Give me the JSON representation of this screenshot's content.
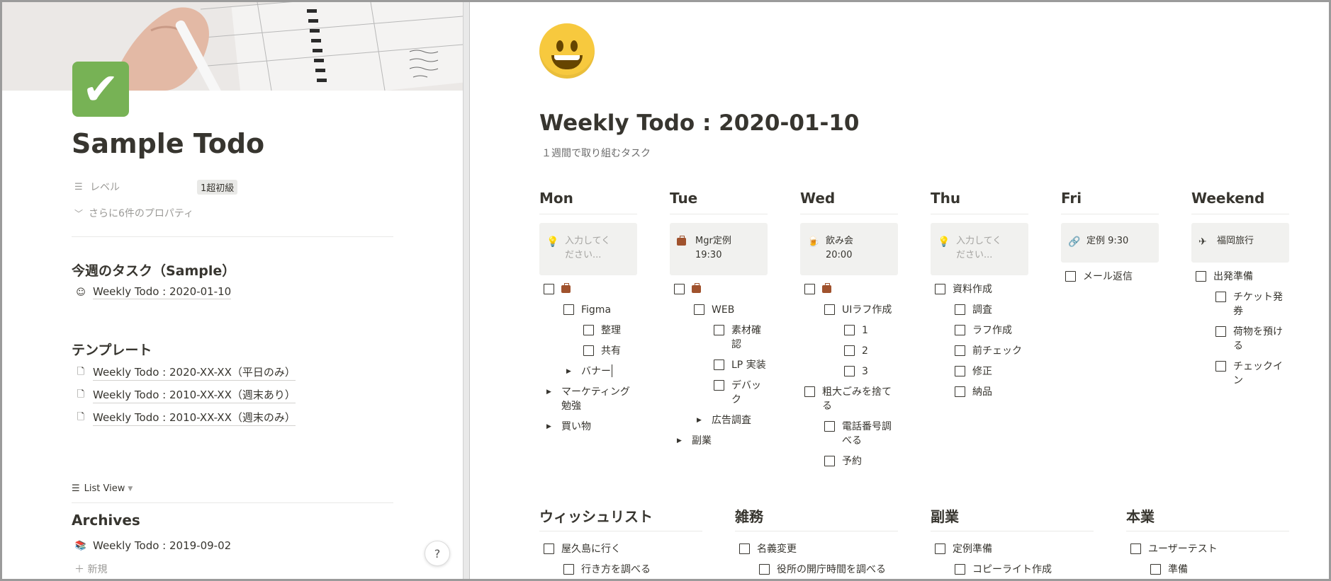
{
  "left": {
    "title": "Sample Todo",
    "property": {
      "name": "レベル",
      "value": "1超初級"
    },
    "more_properties": "さらに6件のプロパティ",
    "this_week": {
      "heading": "今週のタスク（Sample）",
      "link": "Weekly Todo : 2020-01-10"
    },
    "templates": {
      "heading": "テンプレート",
      "items": [
        "Weekly Todo : 2020-XX-XX（平日のみ）",
        "Weekly Todo : 2010-XX-XX（週末あり）",
        "Weekly Todo : 2010-XX-XX（週末のみ）"
      ]
    },
    "list_view": "List View",
    "archives": {
      "heading": "Archives",
      "item": "Weekly Todo : 2019-09-02"
    },
    "new_label": "新規",
    "help": "?"
  },
  "right": {
    "title": "Weekly Todo : 2020-01-10",
    "subtitle": "１週間で取り組むタスク",
    "days": [
      {
        "name": "Mon",
        "card": "入力してく\nださい...",
        "card_placeholder": true
      },
      {
        "name": "Tue",
        "card": "Mgr定例\n19:30"
      },
      {
        "name": "Wed",
        "card": "飲み会\n20:00"
      },
      {
        "name": "Thu",
        "card": "入力してく\nださい...",
        "card_placeholder": true
      },
      {
        "name": "Fri",
        "card": "定例 9:30"
      },
      {
        "name": "Weekend",
        "card": "福岡旅行"
      }
    ],
    "tasks": {
      "mon": [
        "Figma",
        "整理",
        "共有",
        "バナー",
        "マーケティング\n勉強",
        "買い物"
      ],
      "tue": [
        "WEB",
        "素材確\n認",
        "LP 実装",
        "デバッ\nク",
        "広告調査",
        "副業"
      ],
      "wed": [
        "UIラフ作成",
        "1",
        "2",
        "3",
        "粗大ごみを捨て\nる",
        "電話番号調\nべる",
        "予約"
      ],
      "thu": [
        "資料作成",
        "調査",
        "ラフ作成",
        "前チェック",
        "修正",
        "納品"
      ],
      "fri": [
        "メール返信"
      ],
      "weekend": [
        "出発準備",
        "チケット発\n券",
        "荷物を預け\nる",
        "チェックイ\nン"
      ]
    },
    "bottom": [
      {
        "heading": "ウィッシュリスト",
        "items": [
          "屋久島に行く",
          "行き方を調べる"
        ]
      },
      {
        "heading": "雑務",
        "items": [
          "名義変更",
          "役所の開庁時間を調べる"
        ]
      },
      {
        "heading": "副業",
        "items": [
          "定例準備",
          "コピーライト作成"
        ]
      },
      {
        "heading": "本業",
        "items": [
          "ユーザーテスト",
          "準備"
        ]
      }
    ]
  },
  "colors": {
    "check_green": "#77b255",
    "text": "#37352f",
    "muted": "#9b9a97",
    "card_bg": "#f1f1ef"
  }
}
